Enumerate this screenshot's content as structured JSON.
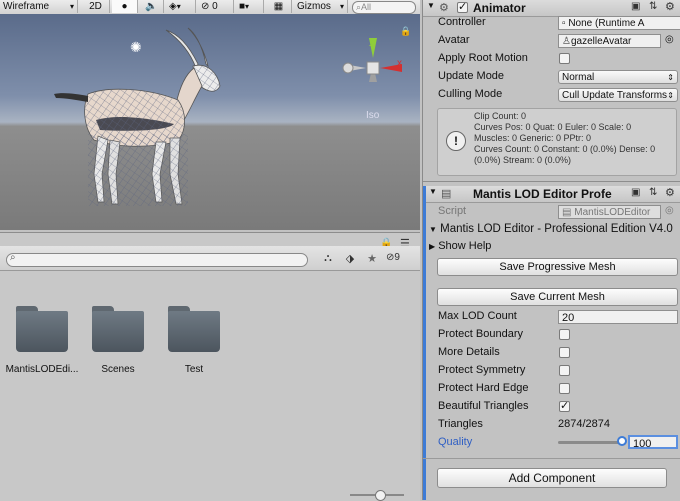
{
  "scene_toolbar": {
    "shading_mode": "Wireframe",
    "mode_2d": "2D",
    "hidden_count": "0",
    "gizmos": "Gizmos",
    "search_placeholder": "All"
  },
  "scene": {
    "persp_label": "Iso",
    "gizmo_axes": {
      "y": "y",
      "x": "x"
    }
  },
  "project": {
    "search_value": "",
    "hidden_count": "9",
    "folders": [
      {
        "name": "MantisLODEdi..."
      },
      {
        "name": "Scenes"
      },
      {
        "name": "Test"
      }
    ]
  },
  "animator": {
    "title": "Animator",
    "enabled": true,
    "controller_label": "Controller",
    "controller_value": "None (Runtime A",
    "avatar_label": "Avatar",
    "avatar_value": "gazelleAvatar",
    "apply_root_motion_label": "Apply Root Motion",
    "apply_root_motion": false,
    "update_mode_label": "Update Mode",
    "update_mode_value": "Normal",
    "culling_mode_label": "Culling Mode",
    "culling_mode_value": "Cull Update Transforms",
    "info_lines": [
      "Clip Count: 0",
      "Curves Pos: 0 Quat: 0 Euler: 0 Scale: 0",
      "Muscles: 0 Generic: 0 PPtr: 0",
      "Curves Count: 0 Constant: 0 (0.0%) Dense: 0",
      "(0.0%) Stream: 0 (0.0%)"
    ]
  },
  "mantis": {
    "title": "Mantis LOD Editor Profe",
    "script_label": "Script",
    "script_value": "MantisLODEditor",
    "edition_text": "Mantis LOD Editor - Professional Edition V4.0",
    "show_help": "Show Help",
    "save_progressive_mesh": "Save Progressive Mesh",
    "save_current_mesh": "Save Current Mesh",
    "max_lod_count_label": "Max LOD Count",
    "max_lod_count_value": "20",
    "protect_boundary_label": "Protect Boundary",
    "protect_boundary": false,
    "more_details_label": "More Details",
    "more_details": false,
    "protect_symmetry_label": "Protect Symmetry",
    "protect_symmetry": false,
    "protect_hard_edge_label": "Protect Hard Edge",
    "protect_hard_edge": false,
    "beautiful_triangles_label": "Beautiful Triangles",
    "beautiful_triangles": true,
    "triangles_label": "Triangles",
    "triangles_value": "2874/2874",
    "quality_label": "Quality",
    "quality_value": "100",
    "quality_fraction": 1.0
  },
  "add_component": "Add Component",
  "colors": {
    "accent_blue": "#3d7bd6",
    "quality_label_blue": "#2f5fc4",
    "gizmo_y_green": "#8fce3a",
    "gizmo_x_red": "#d43030"
  }
}
